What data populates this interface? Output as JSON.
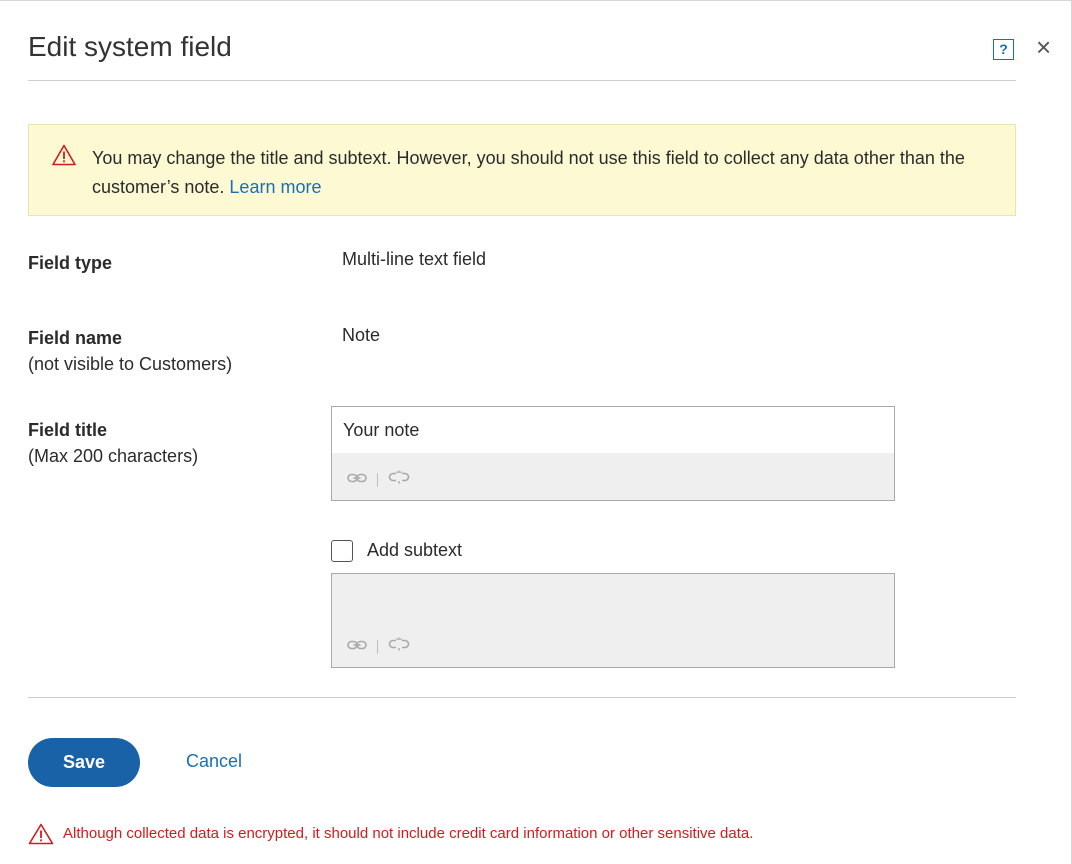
{
  "dialog": {
    "title": "Edit system field",
    "help_label": "?",
    "close_label": "×"
  },
  "banner": {
    "message": "You may change the title and subtext. However, you should not use this field to collect any data other than the customer’s note.",
    "link": "Learn more"
  },
  "fields": {
    "type": {
      "label": "Field type",
      "value": "Multi-line text field"
    },
    "name": {
      "label": "Field name",
      "sublabel": "(not visible to Customers)",
      "value": "Note"
    },
    "title": {
      "label": "Field title",
      "sublabel": "(Max 200 characters)",
      "value": "Your note"
    }
  },
  "subtext": {
    "checkbox_label": "Add subtext",
    "checked": false,
    "value": ""
  },
  "actions": {
    "save": "Save",
    "cancel": "Cancel"
  },
  "footer": {
    "warning": "Although collected data is encrypted, it should not include credit card information or other sensitive data."
  },
  "colors": {
    "accent": "#1a62a8",
    "link": "#1a6fb3",
    "warning_bg": "#fdfad3",
    "warning_icon": "#d21c1c"
  },
  "icons": [
    "warning-icon",
    "help-icon",
    "close-icon",
    "link-icon",
    "unlink-icon"
  ]
}
